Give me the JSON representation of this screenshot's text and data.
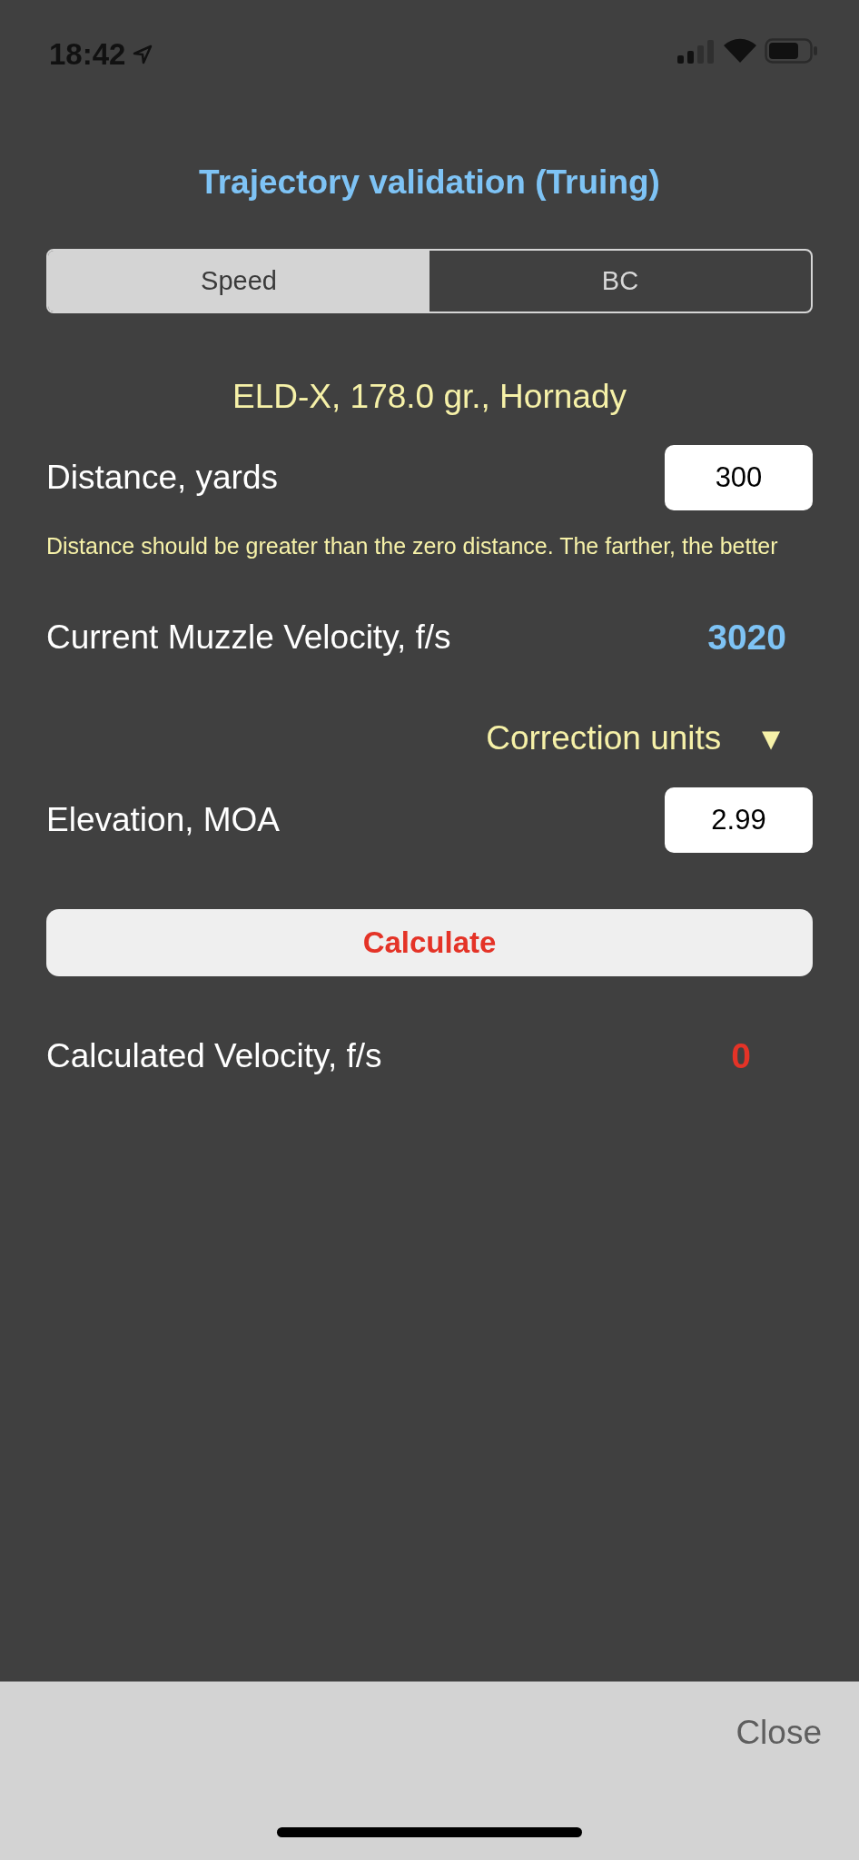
{
  "status_bar": {
    "time": "18:42"
  },
  "title": "Trajectory validation (Truing)",
  "segments": [
    {
      "label": "Speed",
      "selected": true
    },
    {
      "label": "BC",
      "selected": false
    }
  ],
  "bullet": "ELD-X, 178.0 gr., Hornady",
  "distance": {
    "label": "Distance, yards",
    "value": "300",
    "hint": "Distance should be greater than the zero distance. The farther, the better"
  },
  "muzzle_velocity": {
    "label": "Current Muzzle Velocity, f/s",
    "value": "3020"
  },
  "correction_units": {
    "label": "Correction units",
    "caret": "▼"
  },
  "elevation": {
    "label": "Elevation, MOA",
    "value": "2.99"
  },
  "calculate_button": "Calculate",
  "calculated_velocity": {
    "label": "Calculated Velocity, f/s",
    "value": "0"
  },
  "close_button": "Close"
}
